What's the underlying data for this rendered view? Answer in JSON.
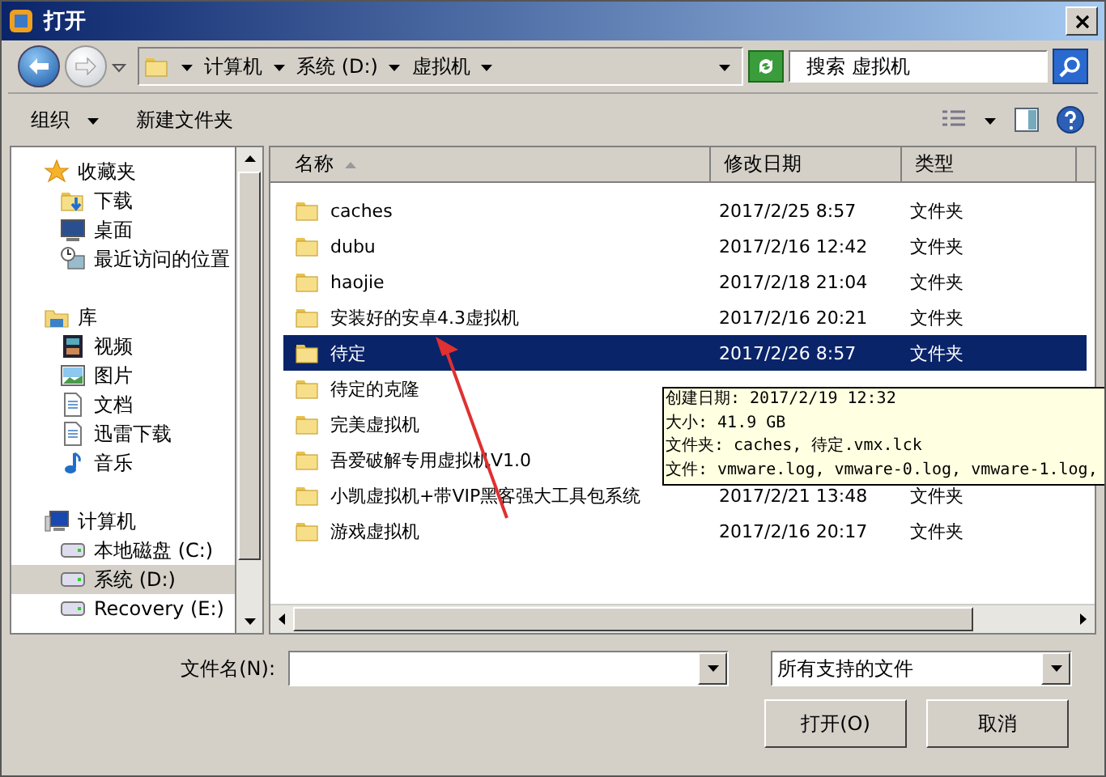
{
  "window": {
    "title": "打开"
  },
  "address_bar": {
    "crumbs": [
      "计算机",
      "系统 (D:)",
      "虚拟机"
    ],
    "search": {
      "placeholder": "搜索 虚拟机"
    }
  },
  "toolbar": {
    "organize": "组织",
    "new_folder": "新建文件夹"
  },
  "sidebar": {
    "items": [
      {
        "label": "收藏夹",
        "selected": false,
        "children": [
          {
            "label": "下载",
            "selected": false
          },
          {
            "label": "桌面",
            "selected": false
          },
          {
            "label": "最近访问的位置",
            "selected": false
          }
        ]
      },
      {
        "label": "库",
        "selected": false,
        "children": [
          {
            "label": "视频",
            "selected": false
          },
          {
            "label": "图片",
            "selected": false
          },
          {
            "label": "文档",
            "selected": false
          },
          {
            "label": "迅雷下载",
            "selected": false
          },
          {
            "label": "音乐",
            "selected": false
          }
        ]
      },
      {
        "label": "计算机",
        "selected": false,
        "children": [
          {
            "label": "本地磁盘 (C:)",
            "selected": false
          },
          {
            "label": "系统 (D:)",
            "selected": true
          },
          {
            "label": "Recovery (E:)",
            "selected": false
          }
        ]
      }
    ]
  },
  "table": {
    "columns": [
      "名称",
      "修改日期",
      "类型"
    ],
    "rows": [
      {
        "name": "caches",
        "date": "2017/2/25 8:57",
        "type": "文件夹",
        "selected": false
      },
      {
        "name": "dubu",
        "date": "2017/2/16 12:42",
        "type": "文件夹",
        "selected": false
      },
      {
        "name": "haojie",
        "date": "2017/2/18 21:04",
        "type": "文件夹",
        "selected": false
      },
      {
        "name": "安装好的安卓4.3虚拟机",
        "date": "2017/2/16 20:21",
        "type": "文件夹",
        "selected": false
      },
      {
        "name": "待定",
        "date": "2017/2/26 8:57",
        "type": "文件夹",
        "selected": true
      },
      {
        "name": "待定的克隆",
        "selected": false
      },
      {
        "name": "完美虚拟机",
        "selected": false
      },
      {
        "name": "吾爱破解专用虚拟机V1.0",
        "selected": false
      },
      {
        "name": "小凯虚拟机+带VIP黑客强大工具包系统",
        "date": "2017/2/21 13:48",
        "type": "文件夹",
        "selected": false
      },
      {
        "name": "游戏虚拟机",
        "date": "2017/2/16 20:17",
        "type": "文件夹",
        "selected": false
      }
    ]
  },
  "tooltip": {
    "lines": [
      "创建日期: 2017/2/19 12:32",
      "大小: 41.9 GB",
      "文件夹: caches, 待定.vmx.lck",
      "文件: vmware.log, vmware-0.log, vmware-1.log,"
    ]
  },
  "footer": {
    "filename_label": "文件名(N):",
    "filter": "所有支持的文件",
    "buttons": [
      "打开(O)",
      "取消"
    ]
  }
}
